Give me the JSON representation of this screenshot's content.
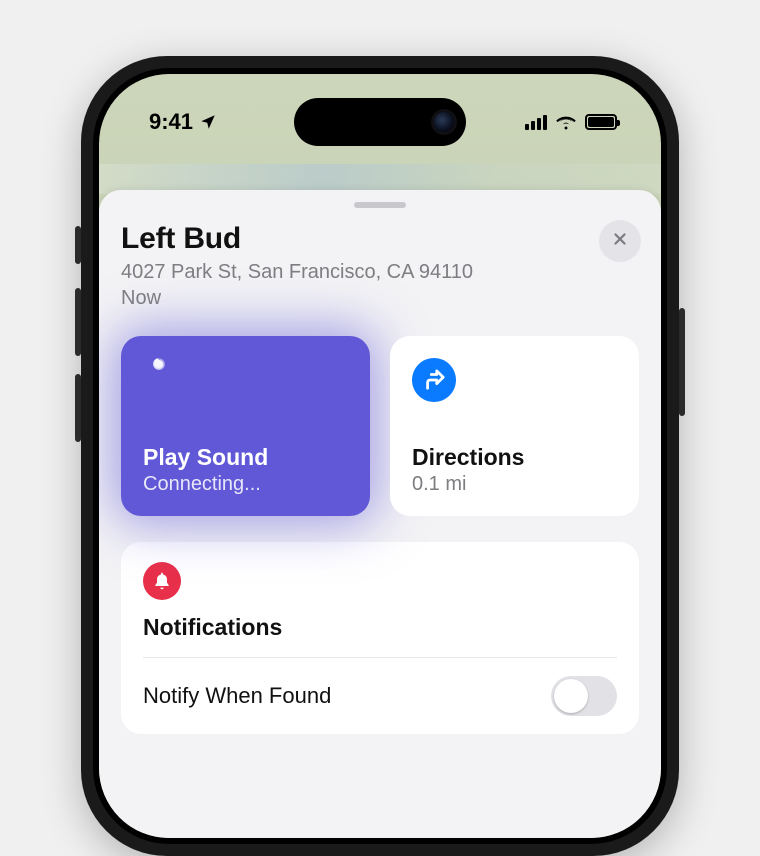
{
  "status": {
    "time": "9:41"
  },
  "sheet": {
    "title": "Left Bud",
    "address": "4027 Park St, San Francisco, CA  94110",
    "timestamp": "Now"
  },
  "actions": {
    "play_sound": {
      "title": "Play Sound",
      "status": "Connecting..."
    },
    "directions": {
      "title": "Directions",
      "distance": "0.1 mi"
    }
  },
  "notifications": {
    "section_title": "Notifications",
    "notify_when_found": {
      "label": "Notify When Found",
      "enabled": false
    }
  }
}
